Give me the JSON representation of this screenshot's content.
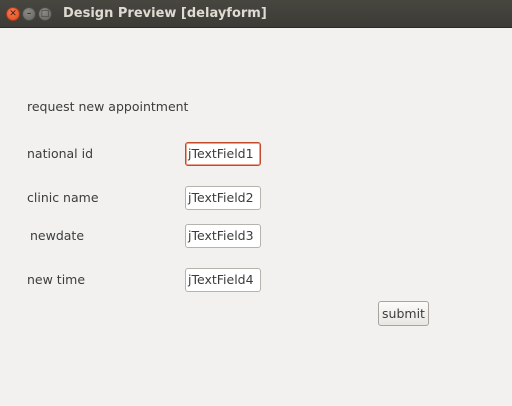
{
  "window": {
    "title": "Design Preview [delayform]"
  },
  "form": {
    "heading": "request new appointment",
    "labels": {
      "national_id": "national id",
      "clinic_name": "clinic name",
      "newdate": "newdate",
      "new_time": "new time"
    },
    "fields": {
      "field1": "jTextField1",
      "field2": "jTextField2",
      "field3": "jTextField3",
      "field4": "jTextField4"
    },
    "submit_label": "submit"
  }
}
